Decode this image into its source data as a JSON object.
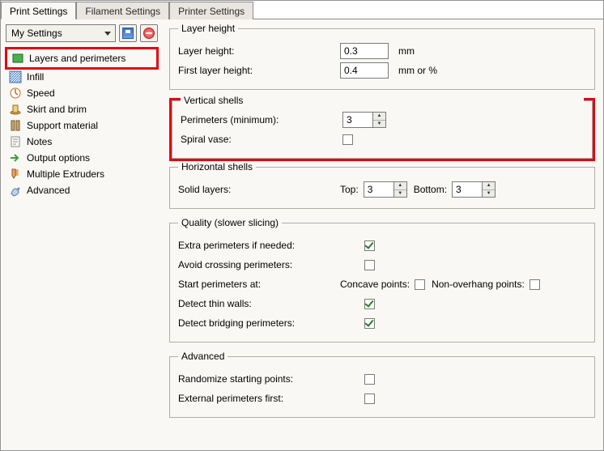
{
  "tabs": {
    "print": "Print Settings",
    "filament": "Filament Settings",
    "printer": "Printer Settings"
  },
  "sidebar": {
    "profile": "My Settings",
    "items": [
      {
        "label": "Layers and perimeters"
      },
      {
        "label": "Infill"
      },
      {
        "label": "Speed"
      },
      {
        "label": "Skirt and brim"
      },
      {
        "label": "Support material"
      },
      {
        "label": "Notes"
      },
      {
        "label": "Output options"
      },
      {
        "label": "Multiple Extruders"
      },
      {
        "label": "Advanced"
      }
    ]
  },
  "layer_height": {
    "legend": "Layer height",
    "layer_height_label": "Layer height:",
    "layer_height_value": "0.3",
    "layer_height_unit": "mm",
    "first_layer_label": "First layer height:",
    "first_layer_value": "0.4",
    "first_layer_unit": "mm or %"
  },
  "vertical_shells": {
    "legend": "Vertical shells",
    "perimeters_label": "Perimeters (minimum):",
    "perimeters_value": "3",
    "spiral_label": "Spiral vase:",
    "spiral_checked": false
  },
  "horizontal_shells": {
    "legend": "Horizontal shells",
    "solid_label": "Solid layers:",
    "top_label": "Top:",
    "top_value": "3",
    "bottom_label": "Bottom:",
    "bottom_value": "3"
  },
  "quality": {
    "legend": "Quality (slower slicing)",
    "extra_label": "Extra perimeters if needed:",
    "extra_checked": true,
    "avoid_label": "Avoid crossing perimeters:",
    "avoid_checked": false,
    "start_label": "Start perimeters at:",
    "concave_label": "Concave points:",
    "concave_checked": false,
    "nonoverhang_label": "Non-overhang points:",
    "nonoverhang_checked": false,
    "thin_label": "Detect thin walls:",
    "thin_checked": true,
    "bridge_label": "Detect bridging perimeters:",
    "bridge_checked": true
  },
  "advanced": {
    "legend": "Advanced",
    "random_label": "Randomize starting points:",
    "random_checked": false,
    "ext_first_label": "External perimeters first:",
    "ext_first_checked": false
  }
}
